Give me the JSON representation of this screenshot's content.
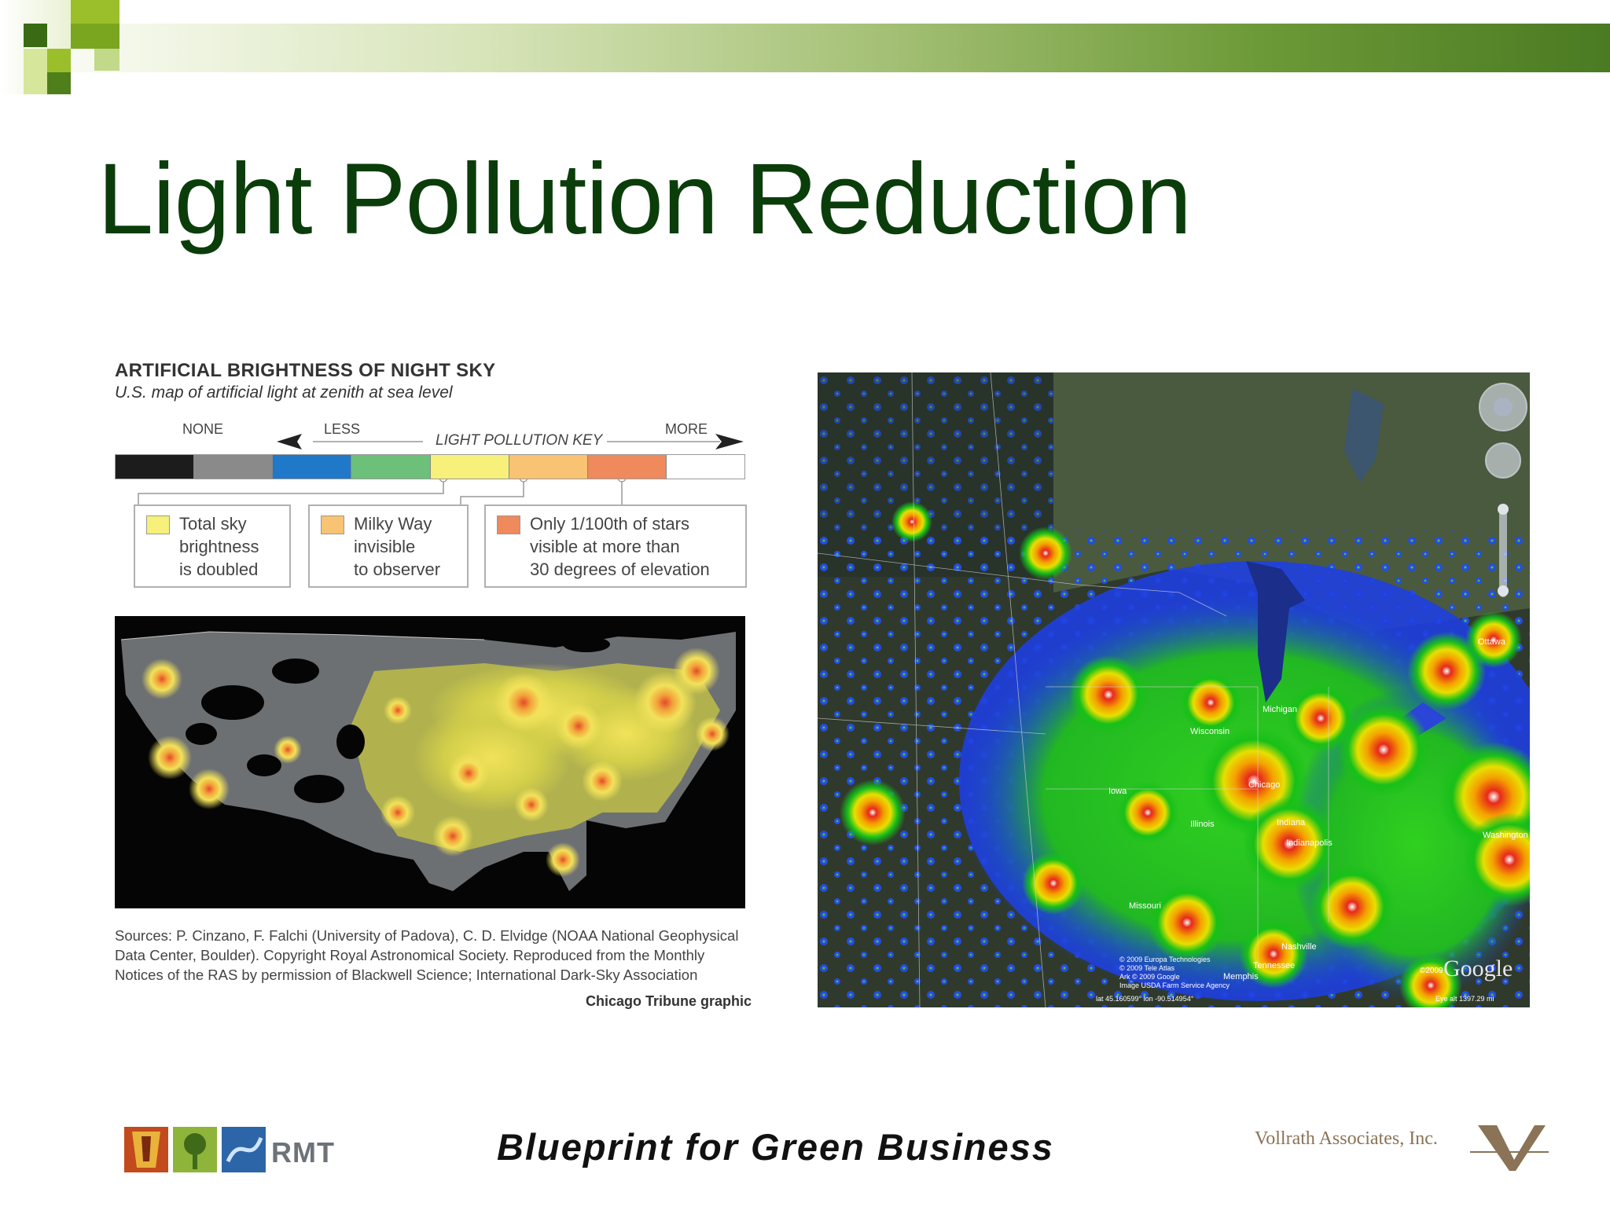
{
  "slide": {
    "title": "Light Pollution Reduction",
    "footer": "Blueprint for Green Business",
    "brand_color": "#0b3d0b",
    "accent_green": "#6d9a38"
  },
  "infographic": {
    "heading": "ARTIFICIAL BRIGHTNESS OF NIGHT SKY",
    "subheading": "U.S. map of artificial light at zenith at sea level",
    "key_none": "NONE",
    "key_less": "LESS",
    "key_title": "LIGHT POLLUTION KEY",
    "key_more": "MORE",
    "key_colors": [
      "#1c1c1c",
      "#8a8a8a",
      "#1f78c8",
      "#6cc07a",
      "#f7f07a",
      "#f8c373",
      "#ee8a5b",
      "#ffffff"
    ],
    "legend": [
      {
        "text": "Total sky\nbrightness\nis doubled",
        "color": "#f7f07a"
      },
      {
        "text": "Milky Way\ninvisible\nto observer",
        "color": "#f8c373"
      },
      {
        "text": "Only 1/100th of stars\nvisible at more than\n30 degrees of elevation",
        "color": "#ee8a5b"
      }
    ],
    "sources": "Sources: P. Cinzano, F. Falchi (University of Padova), C. D. Elvidge (NOAA National Geophysical Data Center, Boulder). Copyright Royal Astronomical Society. Reproduced from the Monthly Notices of the RAS by permission of Blackwell Science; International Dark-Sky Association",
    "credit": "Chicago Tribune graphic"
  },
  "map": {
    "places": {
      "ottawa": "Ottawa",
      "michigan": "Michigan",
      "wisconsin": "Wisconsin",
      "iowa": "Iowa",
      "chicago": "Chicago",
      "illinois": "Illinois",
      "indiana": "Indiana",
      "indianapolis": "Indianapolis",
      "washington": "Washington",
      "missouri": "Missouri",
      "nashville": "Nashville",
      "tennessee": "Tennessee",
      "memphis": "Memphis"
    },
    "attribution": [
      "© 2009 Europa Technologies",
      "© 2009 Tele Atlas",
      "Ark © 2009 Google",
      "Image USDA Farm Service Agency"
    ],
    "coords": "lat  45.160599°   lon  -90.514954°",
    "eye_alt": "Eye alt  1397.29 mi",
    "google_logo": "Google",
    "google_year": "©2009"
  },
  "logos": {
    "rmt": "RMT",
    "vollrath": "Vollrath Associates, Inc."
  }
}
